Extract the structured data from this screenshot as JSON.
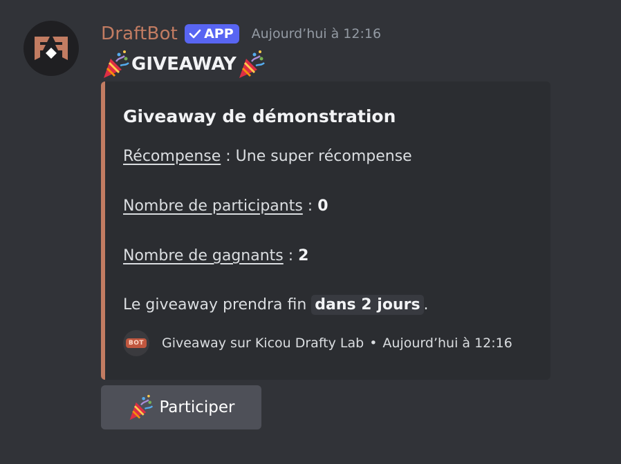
{
  "message": {
    "author": "DraftBot",
    "badge": "APP",
    "timestamp": "Aujourd’hui à 12:16",
    "content": "GIVEAWAY"
  },
  "embed": {
    "title": "Giveaway de démonstration",
    "reward_label": "Récompense",
    "reward_value": " : Une super récompense",
    "participants_label": "Nombre de participants",
    "participants_sep": " : ",
    "participants_value": "0",
    "winners_label": "Nombre de gagnants",
    "winners_sep": " : ",
    "winners_value": "2",
    "end_prefix": "Le giveaway prendra fin ",
    "end_value": "dans 2 jours",
    "end_suffix": ".",
    "footer_icon_text": "BOT",
    "footer_text": "Giveaway sur Kicou Drafty Lab",
    "footer_separator": "•",
    "footer_time": "Aujourd’hui à 12:16",
    "accent_color": "#c27c62"
  },
  "button": {
    "label": "Participer",
    "icon": "party-popper-icon"
  },
  "colors": {
    "background": "#313338",
    "embed_bg": "#2b2d31",
    "badge": "#5865f2",
    "button": "#4e5058"
  }
}
